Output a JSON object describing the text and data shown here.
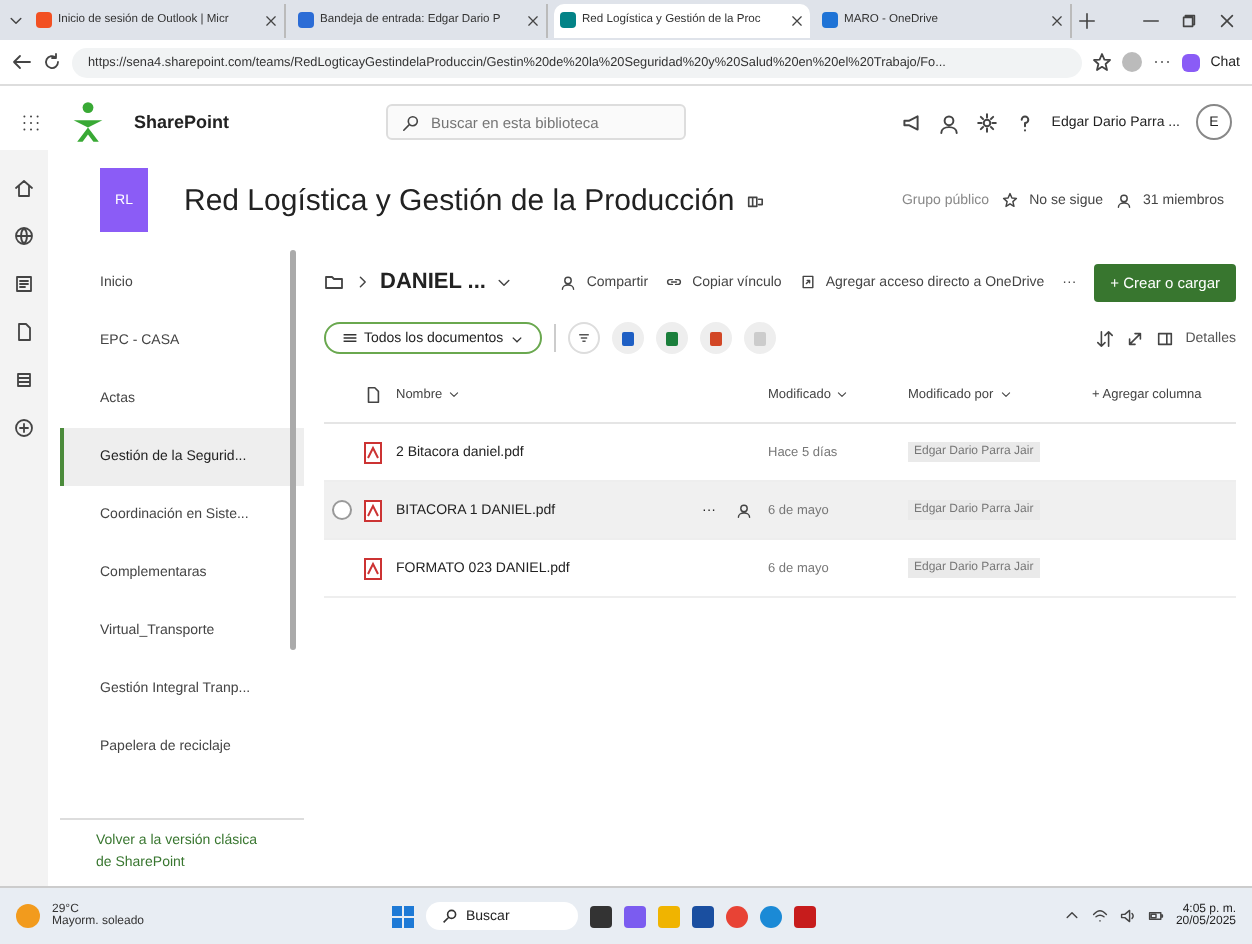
{
  "browser": {
    "tabs": [
      {
        "label": "Inicio de sesión de Outlook | Micr",
        "selected": false,
        "kind": "grid"
      },
      {
        "label": "Bandeja de entrada: Edgar Dario P",
        "selected": false,
        "kind": "mail"
      },
      {
        "label": "Red Logística y Gestión de la Proc",
        "selected": true,
        "kind": "sharepoint"
      },
      {
        "label": "MARO - OneDrive",
        "selected": false,
        "kind": "cloud"
      }
    ],
    "url": "https://sena4.sharepoint.com/teams/RedLogticayGestindelaProduccin/Gestin%20de%20la%20Seguridad%20y%20Salud%20en%20el%20Trabajo/Fo...",
    "chat": "Chat"
  },
  "suite_bar": {
    "app": "SharePoint",
    "search_placeholder": "Buscar en esta biblioteca",
    "user": "Edgar Dario Parra ...",
    "avatar": "E"
  },
  "site": {
    "logo": "RL",
    "title": "Red Logística y Gestión de la Producción",
    "privacy": "Grupo público",
    "follow": "No se sigue",
    "members": "31 miembros"
  },
  "nav": {
    "items": [
      {
        "label": "Inicio",
        "selected": false
      },
      {
        "label": "EPC - CASA",
        "selected": false
      },
      {
        "label": "Actas",
        "selected": false
      },
      {
        "label": "Gestión de la Segurid...",
        "selected": true
      },
      {
        "label": "Coordinación en Siste...",
        "selected": false
      },
      {
        "label": "Complementaras",
        "selected": false
      },
      {
        "label": "Virtual_Transporte",
        "selected": false
      },
      {
        "label": "Gestión Integral Tranp...",
        "selected": false
      },
      {
        "label": "Papelera de reciclaje",
        "selected": false
      }
    ],
    "classic_link": "Volver a la versión clásica de SharePoint"
  },
  "command_bar": {
    "breadcrumb": "DANIEL ...",
    "actions": [
      "Compartir",
      "Copiar vínculo",
      "Agregar acceso directo a OneDrive"
    ],
    "more": "···",
    "create": "+ Crear o cargar"
  },
  "view_bar": {
    "view": "Todos los documentos",
    "details": "Detalles"
  },
  "table": {
    "columns": [
      "Nombre",
      "Modificado",
      "Modificado por",
      "+ Agregar columna"
    ],
    "rows": [
      {
        "name": "2 Bitacora daniel.pdf",
        "modified": "Hace 5 días",
        "modified_by": "Edgar Dario Parra Jair",
        "selected": false
      },
      {
        "name": "BITACORA 1 DANIEL.pdf",
        "modified": "6 de mayo",
        "modified_by": "Edgar Dario Parra Jair",
        "selected": true
      },
      {
        "name": "FORMATO 023 DANIEL.pdf",
        "modified": "6 de mayo",
        "modified_by": "Edgar Dario Parra Jair",
        "selected": false
      }
    ],
    "row_more": "···"
  },
  "taskbar": {
    "temperature": "29°C",
    "weather": "Mayorm. soleado",
    "search": "Buscar",
    "time": "4:05 p. m.",
    "date": "20/05/2025"
  }
}
